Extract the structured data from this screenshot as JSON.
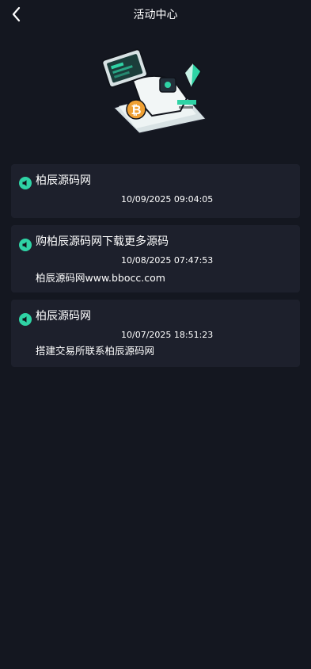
{
  "header": {
    "title": "活动中心",
    "back_icon": "chevron-left-icon"
  },
  "hero": {
    "illustration": "crypto-exchange-illustration"
  },
  "notices": [
    {
      "icon": "speaker-icon",
      "title": "柏辰源码网",
      "time": "10/09/2025 09:04:05",
      "body": ""
    },
    {
      "icon": "speaker-icon",
      "title": "购柏辰源码网下载更多源码",
      "time": "10/08/2025 07:47:53",
      "body": "柏辰源码网www.bbocc.com"
    },
    {
      "icon": "speaker-icon",
      "title": "柏辰源码网",
      "time": "10/07/2025 18:51:23",
      "body": "搭建交易所联系柏辰源码网"
    }
  ],
  "colors": {
    "background": "#141720",
    "card": "#1d202c",
    "accent": "#2fd3a5",
    "bitcoin": "#f0a032"
  }
}
